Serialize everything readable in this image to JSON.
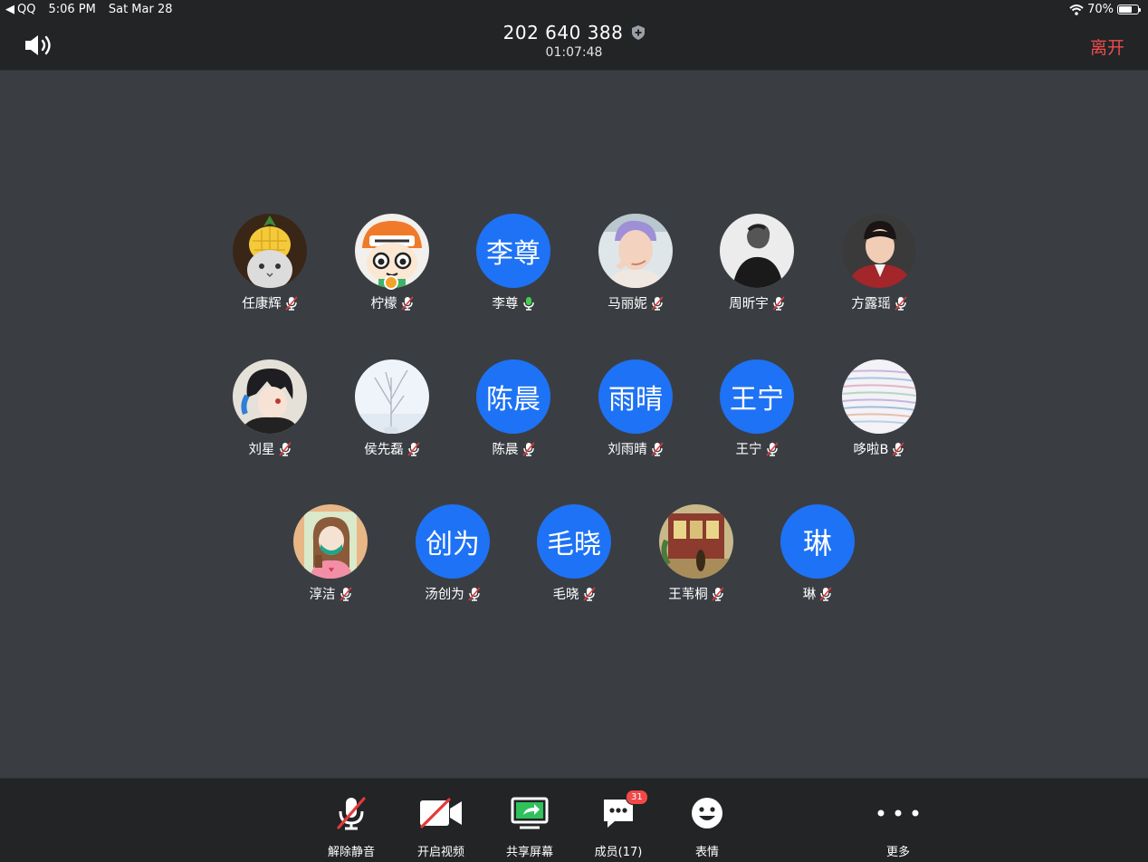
{
  "status_bar": {
    "back_app": "QQ",
    "time": "5:06 PM",
    "date": "Sat Mar 28",
    "battery": "70%",
    "battery_level": 0.7
  },
  "header": {
    "meeting_id": "202 640 388",
    "elapsed": "01:07:48",
    "leave_label": "离开"
  },
  "participants": [
    {
      "name": "任康辉",
      "avatar_icon": "pineapple-cat-photo",
      "mic": "muted"
    },
    {
      "name": "柠檬",
      "avatar_icon": "cartoon-photo",
      "mic": "muted",
      "host": true
    },
    {
      "name": "李尊",
      "avatar_text": "李尊",
      "mic": "active"
    },
    {
      "name": "马丽妮",
      "avatar_icon": "person-photo",
      "mic": "muted"
    },
    {
      "name": "周昕宇",
      "avatar_icon": "bw-portrait-photo",
      "mic": "muted"
    },
    {
      "name": "方露瑶",
      "avatar_icon": "portrait-photo",
      "mic": "muted"
    },
    {
      "name": "刘星",
      "avatar_icon": "anime-photo",
      "mic": "muted"
    },
    {
      "name": "侯先磊",
      "avatar_icon": "winter-tree-photo",
      "mic": "muted"
    },
    {
      "name": "陈晨",
      "avatar_text": "陈晨",
      "mic": "muted"
    },
    {
      "name": "刘雨晴",
      "avatar_text": "雨晴",
      "mic": "muted"
    },
    {
      "name": "王宁",
      "avatar_text": "王宁",
      "mic": "muted"
    },
    {
      "name": "哆啦B",
      "avatar_icon": "abstract-lines-photo",
      "mic": "muted"
    },
    {
      "name": "淳洁",
      "avatar_icon": "illustration-girl-photo",
      "mic": "muted"
    },
    {
      "name": "汤创为",
      "avatar_text": "创为",
      "mic": "muted"
    },
    {
      "name": "毛晓",
      "avatar_text": "毛晓",
      "mic": "muted"
    },
    {
      "name": "王苇桐",
      "avatar_icon": "street-scene-photo",
      "mic": "muted"
    },
    {
      "name": "琳",
      "avatar_text": "琳",
      "mic": "muted"
    }
  ],
  "toolbar": {
    "unmute": "解除静音",
    "start_video": "开启视频",
    "share_screen": "共享屏幕",
    "members": "成员(17)",
    "members_badge": "31",
    "reactions": "表情",
    "more": "更多"
  },
  "colors": {
    "accent_blue": "#1e72f5",
    "leave_red": "#ee4d4d",
    "share_green": "#2fc15b",
    "mic_active": "#3fd14e",
    "mic_muted_slash": "#e23a3a"
  }
}
